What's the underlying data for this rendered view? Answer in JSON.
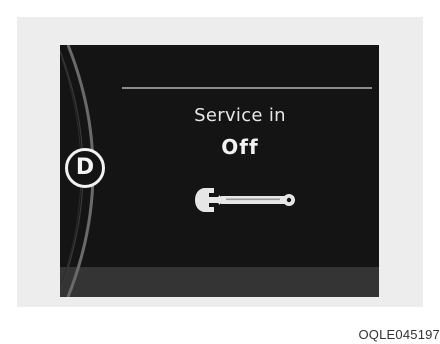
{
  "display": {
    "gear": "D",
    "service_label": "Service in",
    "service_value": "Off",
    "wrench_icon": "wrench-icon"
  },
  "caption": {
    "code": "OQLE045197"
  }
}
